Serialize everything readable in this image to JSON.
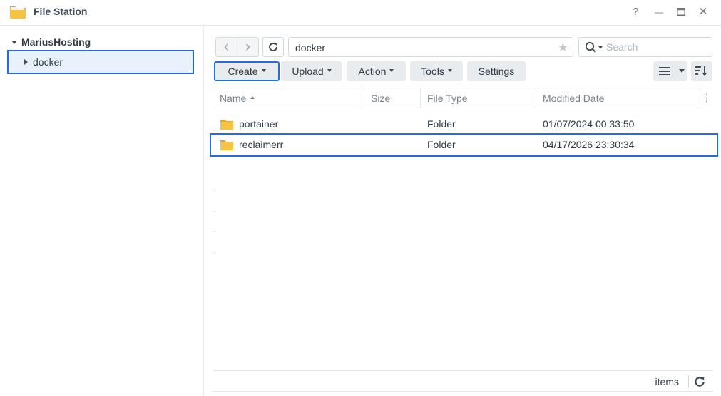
{
  "window": {
    "title": "File Station",
    "controls": {
      "help": "?",
      "minimize": "—",
      "maximize": "▭",
      "close": "✕"
    }
  },
  "sidebar": {
    "root_label": "MariusHosting",
    "items": [
      {
        "label": "docker",
        "selected": true
      }
    ]
  },
  "path_bar": {
    "back": "‹",
    "forward": "›",
    "path": "docker"
  },
  "search": {
    "placeholder": "Search"
  },
  "toolbar": {
    "create": "Create",
    "upload": "Upload",
    "action": "Action",
    "tools": "Tools",
    "settings": "Settings"
  },
  "columns": {
    "name": "Name",
    "size": "Size",
    "type": "File Type",
    "modified": "Modified Date"
  },
  "files": [
    {
      "name": "portainer",
      "size": "",
      "type": "Folder",
      "modified": "01/07/2024 00:33:50",
      "selected": false
    },
    {
      "name": "reclaimerr",
      "size": "",
      "type": "Folder",
      "modified": "04/17/2026 23:30:34",
      "selected": true
    }
  ],
  "footer": {
    "items_label": "items"
  },
  "colors": {
    "accent": "#1f6fde",
    "selection_bg": "#e8f1fc",
    "folder": "#f6c343"
  }
}
